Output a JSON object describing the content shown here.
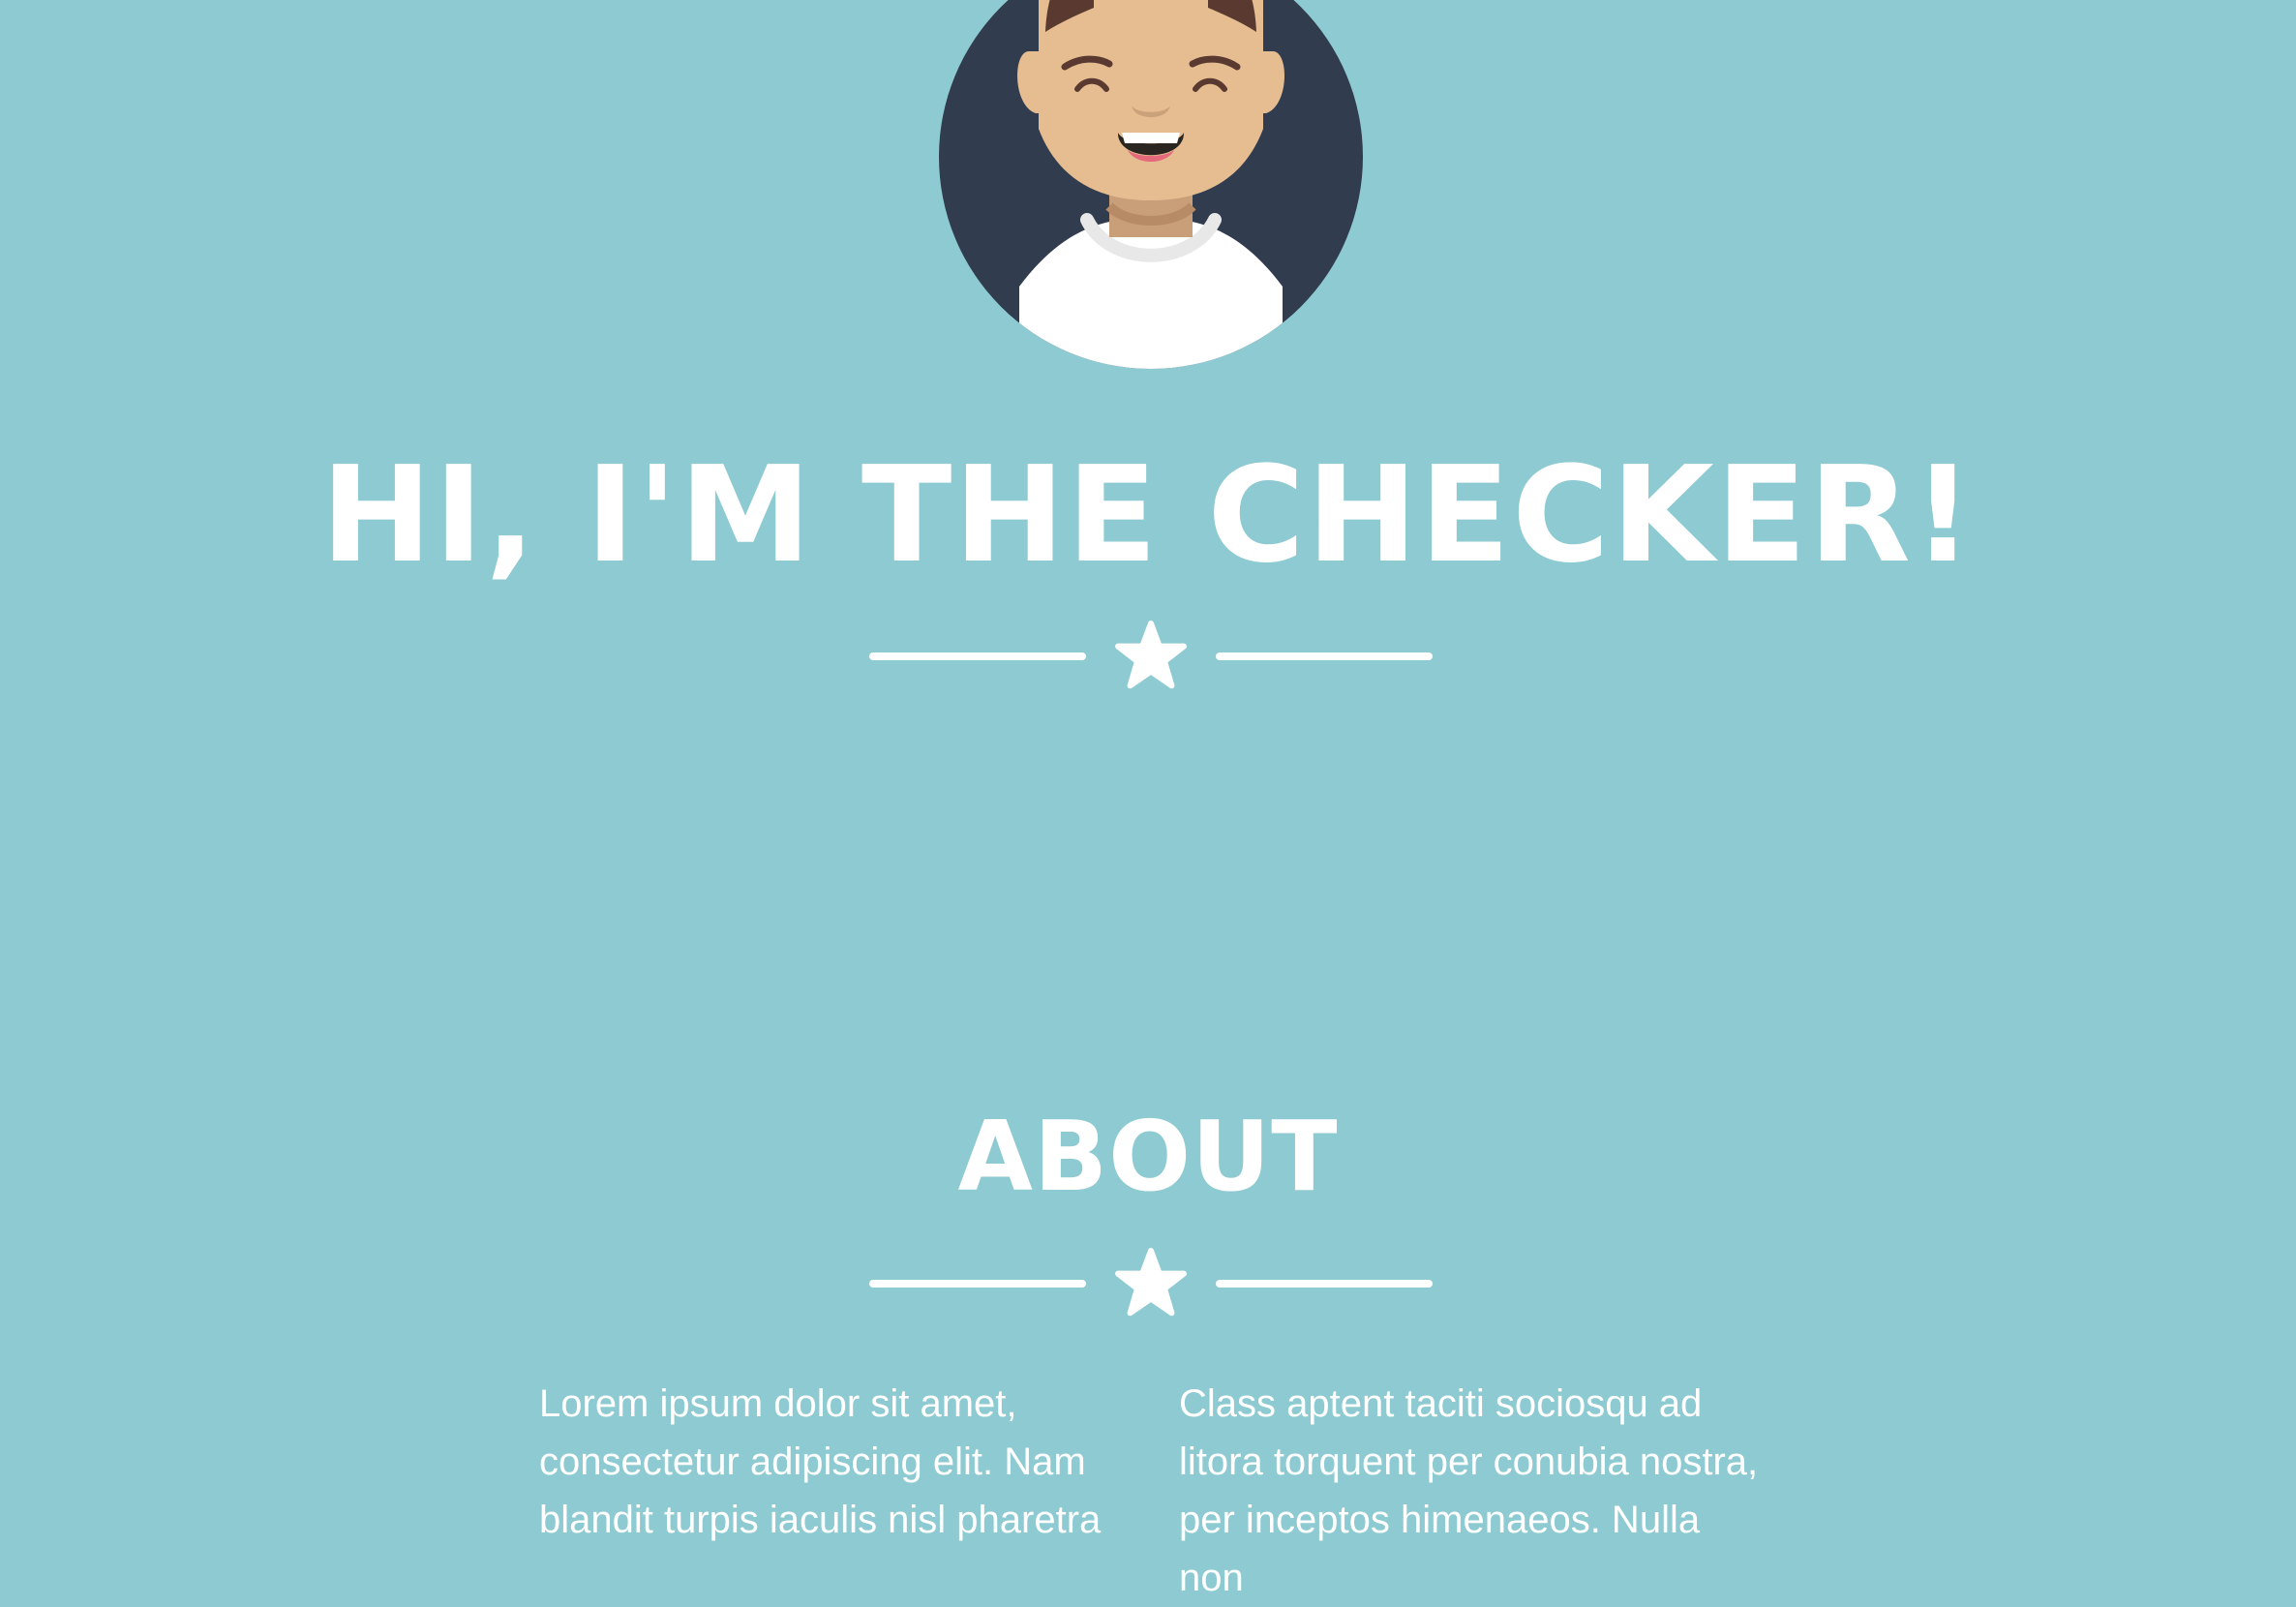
{
  "colors": {
    "background": "#8dcad1",
    "text": "#ffffff",
    "avatar_circle": "#313c4f"
  },
  "avatar": {
    "icon": "avatar-icon"
  },
  "hero": {
    "title": "HI, I'M THE CHECKER!",
    "divider_icon": "star-icon"
  },
  "about": {
    "title": "ABOUT",
    "divider_icon": "star-icon",
    "left_text": "Lorem ipsum dolor sit amet, consectetur adipiscing elit. Nam blandit turpis iaculis nisl pharetra",
    "right_text": "Class aptent taciti sociosqu ad litora torquent per conubia nostra, per inceptos himenaeos. Nulla non"
  }
}
